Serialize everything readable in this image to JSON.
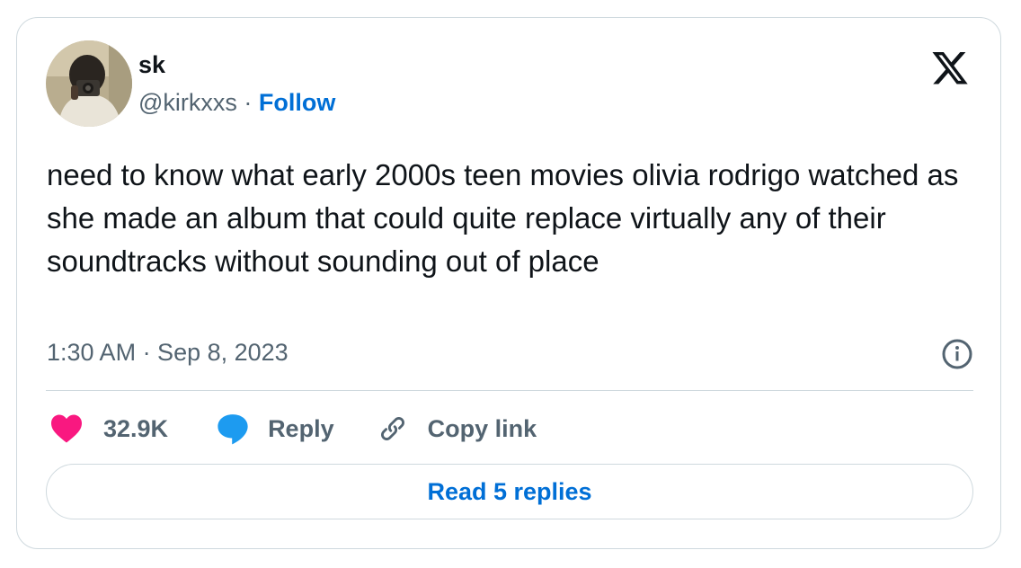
{
  "author": {
    "display_name": "sk",
    "handle": "@kirkxxs",
    "separator": "·",
    "follow_label": "Follow"
  },
  "tweet": {
    "text": "need to know what early 2000s teen movies olivia rodrigo watched as she made an album that could quite replace virtually any of their soundtracks without sounding out of place",
    "timestamp": "1:30 AM · Sep 8, 2023"
  },
  "actions": {
    "like_count": "32.9K",
    "reply_label": "Reply",
    "copy_link_label": "Copy link"
  },
  "read_replies_label": "Read 5 replies",
  "icons": {
    "logo": "x-logo-icon",
    "info": "info-icon",
    "like": "heart-icon",
    "reply": "speech-bubble-icon",
    "copy": "link-icon"
  },
  "colors": {
    "text_primary": "#0f1419",
    "text_secondary": "#536471",
    "link_blue": "#006fd6",
    "like_pink": "#f91880",
    "reply_blue": "#1d9bf0",
    "border": "#cfd9de"
  }
}
